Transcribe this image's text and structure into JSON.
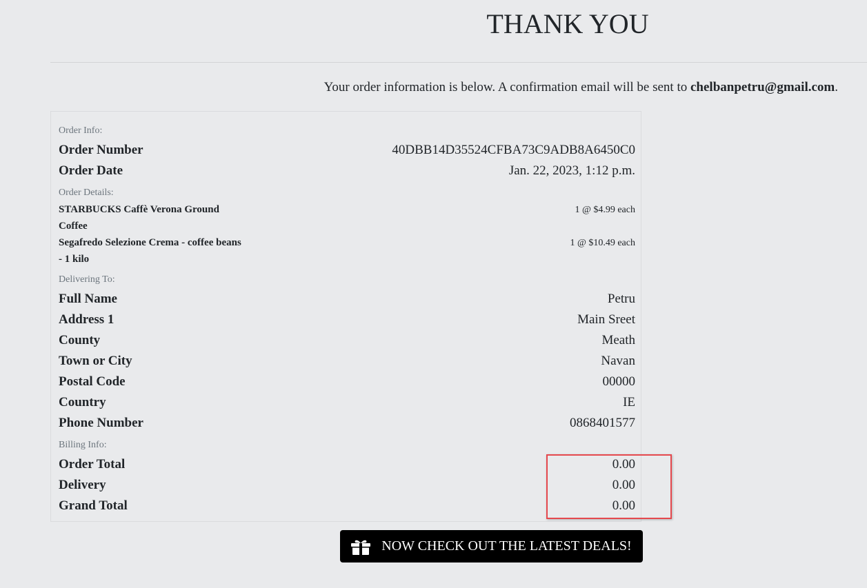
{
  "header": {
    "title": "THANK YOU"
  },
  "intro": {
    "text": "Your order information is below. A confirmation email will be sent to ",
    "email": "chelbanpetru@gmail.com",
    "suffix": "."
  },
  "order": {
    "sections": {
      "order_info": "Order Info:",
      "order_details": "Order Details:",
      "delivering_to": "Delivering To:",
      "billing_info": "Billing Info:"
    },
    "order_number_label": "Order Number",
    "order_number": "40DBB14D35524CFBA73C9ADB8A6450C0",
    "order_date_label": "Order Date",
    "order_date": "Jan. 22, 2023, 1:12 p.m.",
    "items": [
      {
        "name": "STARBUCKS Caffè Verona Ground Coffee",
        "qty": "1 @ $4.99 each"
      },
      {
        "name": "Segafredo Selezione Crema - coffee beans - 1 kilo",
        "qty": "1 @ $10.49 each"
      }
    ],
    "delivery": [
      {
        "label": "Full Name",
        "value": "Petru"
      },
      {
        "label": "Address 1",
        "value": "Main Sreet"
      },
      {
        "label": "County",
        "value": "Meath"
      },
      {
        "label": "Town or City",
        "value": "Navan"
      },
      {
        "label": "Postal Code",
        "value": "00000"
      },
      {
        "label": "Country",
        "value": "IE"
      },
      {
        "label": "Phone Number",
        "value": "0868401577"
      }
    ],
    "billing": [
      {
        "label": "Order Total",
        "value": "0.00"
      },
      {
        "label": "Delivery",
        "value": "0.00"
      },
      {
        "label": "Grand Total",
        "value": "0.00"
      }
    ]
  },
  "deals_button": {
    "label": "NOW CHECK OUT THE LATEST DEALS!",
    "icon": "gift-icon"
  },
  "colors": {
    "background": "#e9eaec",
    "highlight": "#e5484d",
    "button": "#000000"
  }
}
